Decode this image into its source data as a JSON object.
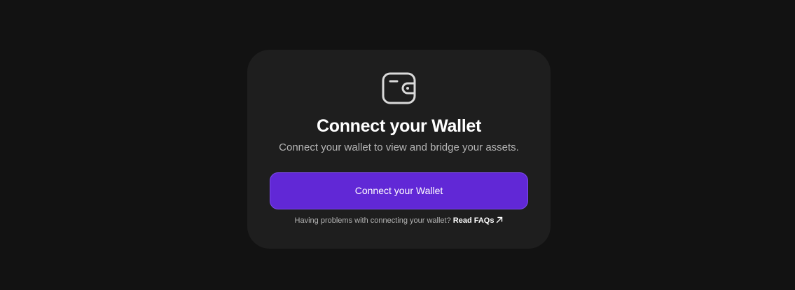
{
  "card": {
    "icon": "wallet-icon",
    "title": "Connect your Wallet",
    "subtitle": "Connect your wallet to view and bridge your assets.",
    "button_label": "Connect your Wallet",
    "help_text": "Having problems with connecting your wallet?",
    "faq_link_label": "Read FAQs",
    "faq_link_icon": "arrow-up-right-icon"
  },
  "colors": {
    "page_background": "#121212",
    "card_background": "#1e1e1e",
    "button_background": "#6128d6",
    "subtitle_text": "#b5b5b5"
  }
}
